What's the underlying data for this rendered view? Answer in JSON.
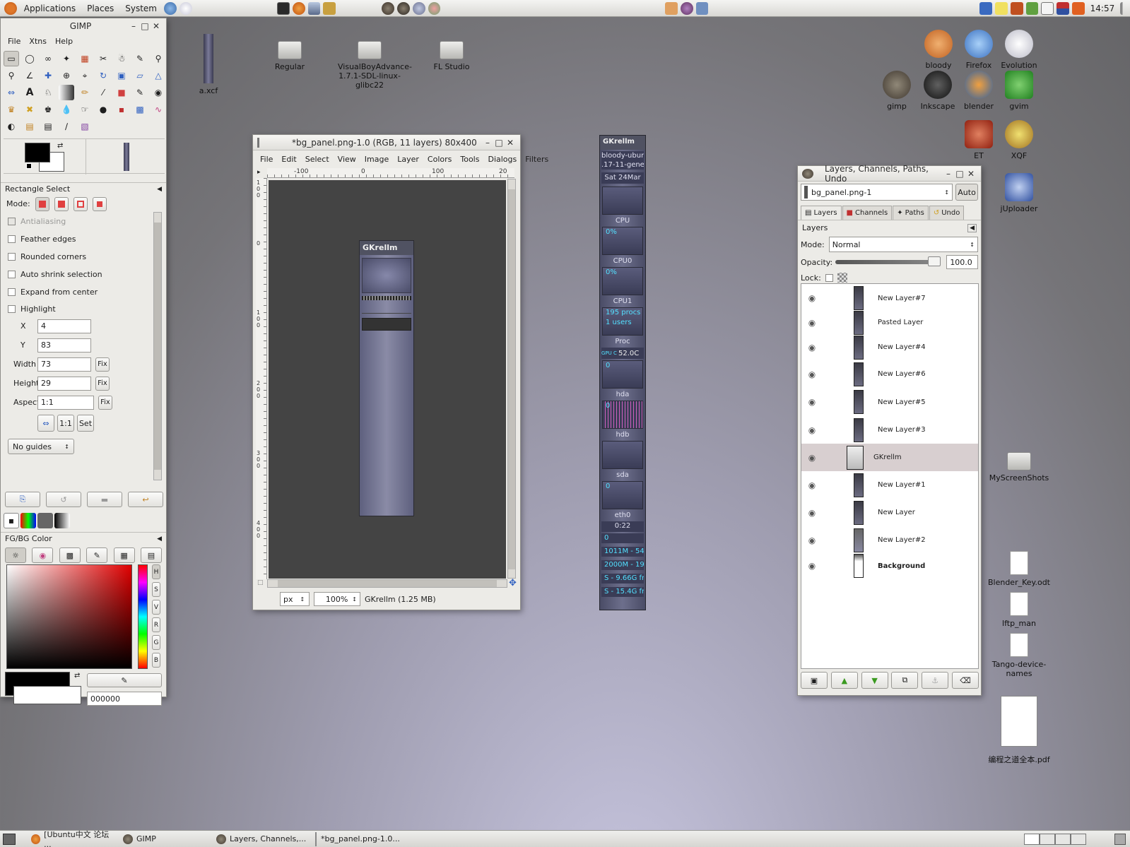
{
  "top_panel": {
    "menus": [
      "Applications",
      "Places",
      "System"
    ],
    "clock": "14:57"
  },
  "bottom_panel": {
    "tasks": [
      {
        "label": "[Ubuntu中文 论坛 ..."
      },
      {
        "label": "GIMP"
      },
      {
        "label": "Layers, Channels,..."
      },
      {
        "label": "*bg_panel.png-1.0..."
      }
    ]
  },
  "toolbox": {
    "title": "GIMP",
    "menu": [
      "File",
      "Xtns",
      "Help"
    ],
    "tool_options_title": "Rectangle Select",
    "mode_label": "Mode:",
    "antialiasing": "Antialiasing",
    "options": [
      "Feather edges",
      "Rounded corners",
      "Auto shrink selection",
      "Expand from center",
      "Highlight"
    ],
    "fields": [
      {
        "label": "X",
        "value": "4"
      },
      {
        "label": "Y",
        "value": "83"
      },
      {
        "label": "Width",
        "value": "73",
        "fix": "Fix"
      },
      {
        "label": "Height",
        "value": "29",
        "fix": "Fix"
      },
      {
        "label": "Aspect",
        "value": "1:1",
        "fix": "Fix"
      }
    ],
    "btn_11": "1:1",
    "btn_set": "Set",
    "guides": "No guides",
    "fgbg_title": "FG/BG Color",
    "hsv_labels": [
      "H",
      "S",
      "V",
      "R",
      "G",
      "B"
    ],
    "hex_value": "000000"
  },
  "image_window": {
    "title": "*bg_panel.png-1.0 (RGB, 11 layers) 80x400",
    "menu": [
      "File",
      "Edit",
      "Select",
      "View",
      "Image",
      "Layer",
      "Colors",
      "Tools",
      "Dialogs",
      "Filters"
    ],
    "ruler_labels": [
      "-100",
      "0",
      "100",
      "20"
    ],
    "vruler_labels": [
      "1\n0\n0",
      "0",
      "1\n0\n0",
      "2\n0\n0",
      "3\n0\n0",
      "4\n0\n0"
    ],
    "unit": "px",
    "zoom": "100%",
    "status": "GKrellm (1.25 MB)",
    "preview_title": "GKrellm"
  },
  "gkrellm": {
    "title": "GKrellm",
    "host": [
      "bloody-ubun",
      ".17-11-gene"
    ],
    "date": "Sat 24Mar",
    "labels": [
      "CPU",
      "CPU0",
      "CPU1",
      "Proc",
      "hda",
      "hdb",
      "sda",
      "eth0"
    ],
    "cpu_pct": "0%",
    "procs": "195 procs",
    "users": "1 users",
    "temp_label": "GPU C",
    "temp": "52.0C",
    "zero": "0",
    "uptime": "0:22",
    "mem": [
      "1011M - 54",
      "2000M - 19",
      "S - 9.66G fr",
      "S - 15.4G fr"
    ]
  },
  "layers": {
    "title": "Layers, Channels, Paths, Undo",
    "image_name": "bg_panel.png-1",
    "auto": "Auto",
    "tabs": [
      "Layers",
      "Channels",
      "Paths",
      "Undo"
    ],
    "section": "Layers",
    "mode_label": "Mode:",
    "mode_value": "Normal",
    "opacity_label": "Opacity:",
    "opacity_value": "100.0",
    "lock_label": "Lock:",
    "items": [
      {
        "name": "New Layer#7"
      },
      {
        "name": "Pasted Layer"
      },
      {
        "name": "New Layer#4"
      },
      {
        "name": "New Layer#6"
      },
      {
        "name": "New Layer#5"
      },
      {
        "name": "New Layer#3"
      },
      {
        "name": "GKrellm",
        "selected": true
      },
      {
        "name": "New Layer#1"
      },
      {
        "name": "New Layer"
      },
      {
        "name": "New Layer#2"
      },
      {
        "name": "Background",
        "bold": true
      }
    ]
  },
  "desktop_icons": {
    "axcf": "a.xcf",
    "regular": "Regular",
    "vba": [
      "VisualBoyAdvance-",
      "1.7.1-SDL-linux-",
      "glibc22"
    ],
    "fl": "FL Studio",
    "bloody": "bloody",
    "firefox": "Firefox",
    "evolution": "Evolution",
    "gimp": "gimp",
    "inkscape": "Inkscape",
    "blender": "blender",
    "gvim": "gvim",
    "et": "ET",
    "xqf": "XQF",
    "juploader": "jUploader",
    "screenshots": "MyScreenShots",
    "blenderkey": "Blender_Key.odt",
    "lftp": "lftp_man",
    "tango": [
      "Tango-device-",
      "names"
    ],
    "pdf": "编程之道全本.pdf"
  },
  "colors": {
    "accent_selected_layer": "#d8cfd0",
    "gkrellm_text": "#53e0ff"
  }
}
